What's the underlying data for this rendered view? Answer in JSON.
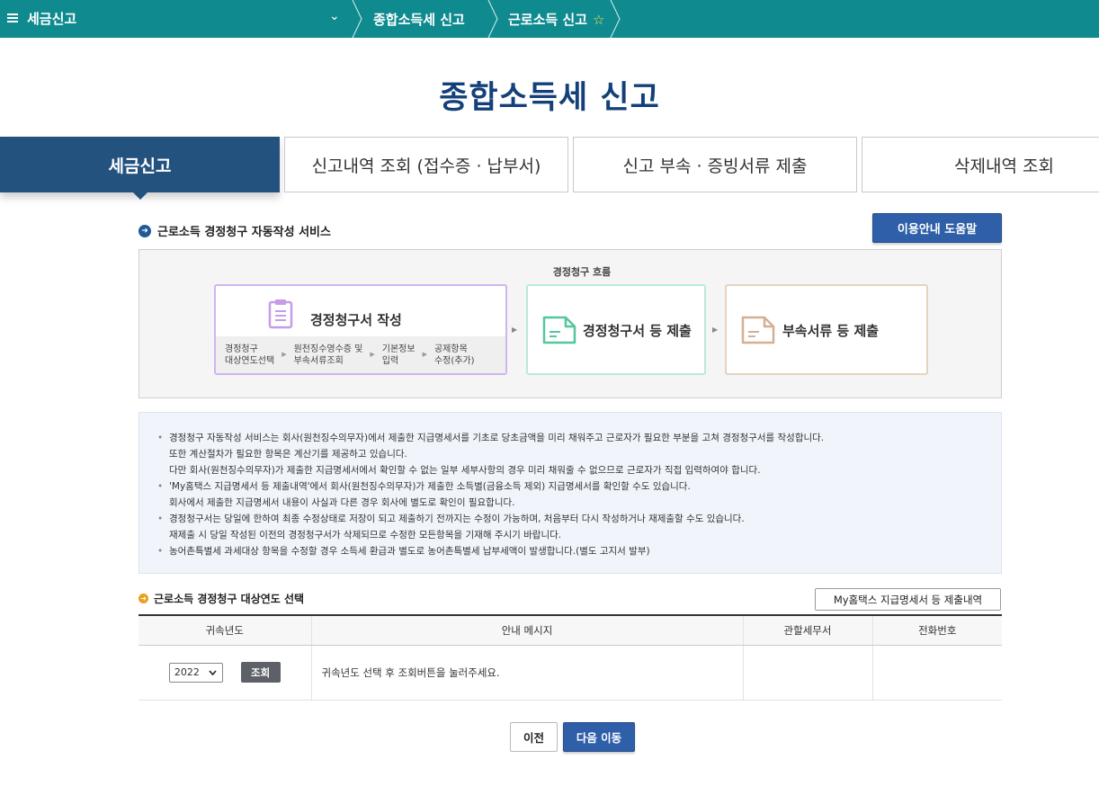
{
  "topbar": {
    "menu_label": "세금신고",
    "breadcrumb": [
      "종합소득세 신고",
      "근로소득 신고"
    ]
  },
  "page_title": "종합소득세 신고",
  "tabs": [
    {
      "label": "세금신고",
      "active": true
    },
    {
      "label": "신고내역 조회 (접수증 · 납부서)",
      "active": false
    },
    {
      "label": "신고 부속 · 증빙서류 제출",
      "active": false
    },
    {
      "label": "삭제내역 조회",
      "active": false
    }
  ],
  "service": {
    "title": "근로소득 경정청구 자동작성 서비스",
    "help_button": "이용안내 도움말"
  },
  "flow": {
    "label": "경정청구 흐름",
    "card1_title": "경정청구서 작성",
    "steps": [
      [
        "경정청구",
        "대상연도선택"
      ],
      [
        "원천징수영수증 및",
        "부속서류조회"
      ],
      [
        "기본정보",
        "입력"
      ],
      [
        "공제항목",
        "수정(추가)"
      ]
    ],
    "card2_title": "경정청구서 등 제출",
    "card3_title": "부속서류 등 제출"
  },
  "notice": [
    {
      "bullet": true,
      "text": "경정청구 자동작성 서비스는 회사(원천징수의무자)에서 제출한 지급명세서를 기초로 당초금액을 미리 채워주고 근로자가 필요한 부분을 고쳐 경정청구서를 작성합니다."
    },
    {
      "bullet": false,
      "text": "또한 계산절차가 필요한 항목은 계산기를 제공하고 있습니다."
    },
    {
      "bullet": false,
      "text": "다만 회사(원천징수의무자)가 제출한 지급명세서에서 확인할 수 없는 일부 세부사항의 경우 미리 채워줄 수 없으므로 근로자가 직접 입력하여야 합니다."
    },
    {
      "bullet": true,
      "text": "'My홈택스 지급명세서 등 제출내역'에서 회사(원천징수의무자)가 제출한 소득별(금융소득 제외) 지급명세서를 확인할 수도 있습니다."
    },
    {
      "bullet": false,
      "text": "회사에서 제출한 지급명세서 내용이 사실과 다른 경우 회사에 별도로 확인이 필요합니다."
    },
    {
      "bullet": true,
      "text": "경정청구서는 당일에 한하여 최종 수정상태로 저장이 되고 제출하기 전까지는 수정이 가능하며, 처음부터 다시 작성하거나 재제출할 수도 있습니다."
    },
    {
      "bullet": false,
      "text": "재제출 시 당일 작성된 이전의 경정청구서가 삭제되므로 수정한 모든항목을 기재해 주시기 바랍니다."
    },
    {
      "bullet": true,
      "text": "농어촌특별세 과세대상 항목을 수정할 경우 소득세 환급과 별도로 농어촌특별세 납부세액이 발생합니다.(별도 고지서 발부)"
    }
  ],
  "year_section": {
    "title": "근로소득 경정청구 대상연도 선택",
    "my_button": "My홈택스 지급명세서 등 제출내역",
    "columns": [
      "귀속년도",
      "안내 메시지",
      "관할세무서",
      "전화번호"
    ],
    "selected_year": "2022",
    "query_button": "조회",
    "message": "귀속년도 선택 후 조회버튼을 눌러주세요.",
    "tax_office": "",
    "phone": ""
  },
  "buttons": {
    "prev": "이전",
    "next": "다음 이동"
  },
  "colors": {
    "topbar": "#0f8a8f",
    "title": "#14407a",
    "active_tab": "#23527f",
    "primary_button": "#2f5fa8"
  }
}
